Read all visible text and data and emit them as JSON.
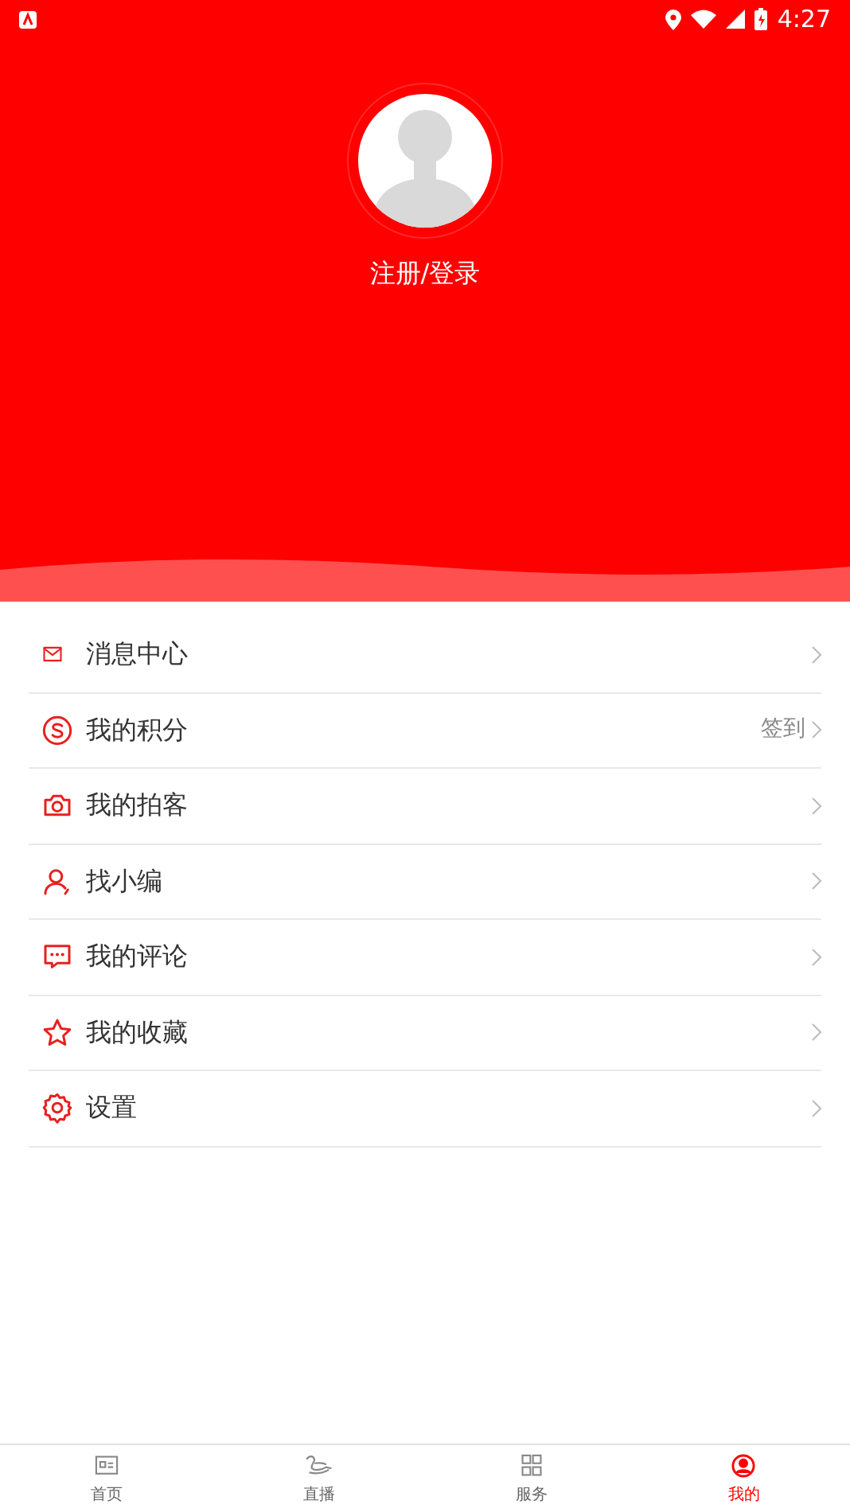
{
  "status_bar": {
    "time": "4:27"
  },
  "profile": {
    "login_label": "注册/登录"
  },
  "menu": [
    {
      "kind": "mail",
      "label": "消息中心"
    },
    {
      "kind": "points",
      "label": "我的积分",
      "action": "签到"
    },
    {
      "kind": "camera",
      "label": "我的拍客"
    },
    {
      "kind": "person",
      "label": "找小编"
    },
    {
      "kind": "comment",
      "label": "我的评论"
    },
    {
      "kind": "star",
      "label": "我的收藏"
    },
    {
      "kind": "settings",
      "label": "设置"
    }
  ],
  "tabs": [
    {
      "kind": "news",
      "label": "首页",
      "selected": false
    },
    {
      "kind": "live",
      "label": "直播",
      "selected": false
    },
    {
      "kind": "grid",
      "label": "服务",
      "selected": false
    },
    {
      "kind": "me",
      "label": "我的",
      "selected": true
    }
  ]
}
